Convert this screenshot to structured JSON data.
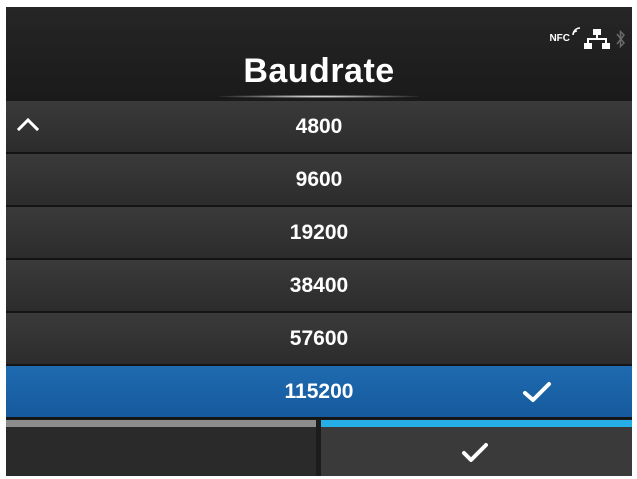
{
  "header": {
    "title": "Baudrate",
    "status": {
      "nfc_label": "NFC",
      "icons": [
        "nfc-icon",
        "network-icon",
        "bluetooth-icon"
      ]
    }
  },
  "list": {
    "scroll_icon": "chevron-up-icon",
    "items": [
      {
        "label": "4800",
        "selected": false
      },
      {
        "label": "9600",
        "selected": false
      },
      {
        "label": "19200",
        "selected": false
      },
      {
        "label": "38400",
        "selected": false
      },
      {
        "label": "57600",
        "selected": false
      },
      {
        "label": "115200",
        "selected": true
      }
    ]
  },
  "footer": {
    "confirm_icon": "checkmark-icon"
  },
  "colors": {
    "selected_row": "#1f6ab0",
    "confirm_accent": "#26aee6",
    "cancel_accent": "#8d8d8d",
    "background": "#1c1c1c"
  }
}
